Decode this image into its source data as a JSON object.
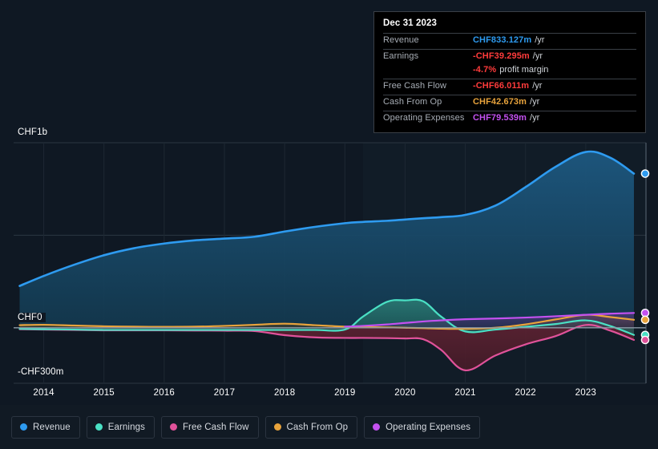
{
  "tooltip": {
    "date": "Dec 31 2023",
    "rows": [
      {
        "key": "Revenue",
        "value": "CHF833.127m",
        "unit": "/yr",
        "color": "#2e9bf0"
      },
      {
        "key": "Earnings",
        "value": "-CHF39.295m",
        "unit": "/yr",
        "color": "#ff3b3b"
      },
      {
        "key": "",
        "value": "-4.7%",
        "unit": "profit margin",
        "color": "#ff3b3b",
        "sub": true
      },
      {
        "key": "Free Cash Flow",
        "value": "-CHF66.011m",
        "unit": "/yr",
        "color": "#ff3b3b"
      },
      {
        "key": "Cash From Op",
        "value": "CHF42.673m",
        "unit": "/yr",
        "color": "#e8a33c"
      },
      {
        "key": "Operating Expenses",
        "value": "CHF79.539m",
        "unit": "/yr",
        "color": "#c451f0"
      }
    ]
  },
  "axes": {
    "y_top": "CHF1b",
    "y_zero": "CHF0",
    "y_bottom": "-CHF300m",
    "x_ticks": [
      "2014",
      "2015",
      "2016",
      "2017",
      "2018",
      "2019",
      "2020",
      "2021",
      "2022",
      "2023"
    ]
  },
  "legend": {
    "items": [
      {
        "label": "Revenue",
        "color": "#2e9bf0"
      },
      {
        "label": "Earnings",
        "color": "#4ae0c4"
      },
      {
        "label": "Free Cash Flow",
        "color": "#e0529a"
      },
      {
        "label": "Cash From Op",
        "color": "#e8a33c"
      },
      {
        "label": "Operating Expenses",
        "color": "#c451f0"
      }
    ]
  },
  "chart_data": {
    "type": "area",
    "title": "",
    "xlabel": "",
    "ylabel": "",
    "currency": "CHF",
    "units": "millions",
    "grid": true,
    "legend_position": "bottom",
    "xlim": [
      2013.5,
      2024.0
    ],
    "ylim": [
      -300,
      1000
    ],
    "y_ticks": [
      1000,
      500,
      0,
      -300
    ],
    "y_tick_labels": [
      "CHF1b",
      "",
      "CHF0",
      "-CHF300m"
    ],
    "x": [
      2013.6,
      2014.0,
      2014.5,
      2015.0,
      2015.5,
      2016.0,
      2016.5,
      2017.0,
      2017.5,
      2018.0,
      2018.5,
      2019.0,
      2019.3,
      2019.7,
      2020.0,
      2020.3,
      2020.6,
      2021.0,
      2021.5,
      2022.0,
      2022.5,
      2023.0,
      2023.4,
      2023.8
    ],
    "series": [
      {
        "name": "Revenue",
        "color": "#2e9bf0",
        "fill": "#16384f",
        "values": [
          226,
          280,
          340,
          392,
          430,
          455,
          472,
          482,
          492,
          520,
          545,
          565,
          572,
          578,
          585,
          592,
          598,
          610,
          660,
          760,
          870,
          950,
          920,
          833
        ]
      },
      {
        "name": "Earnings",
        "color": "#4ae0c4",
        "fill": "#1d5d5b",
        "values": [
          -6,
          -8,
          -10,
          -12,
          -12,
          -12,
          -12,
          -12,
          -12,
          -12,
          -12,
          -10,
          60,
          140,
          148,
          143,
          60,
          -20,
          -10,
          5,
          20,
          40,
          10,
          -39
        ]
      },
      {
        "name": "Free Cash Flow",
        "color": "#e0529a",
        "fill": "#5a2030",
        "values": [
          -8,
          -10,
          -12,
          -14,
          -14,
          -14,
          -15,
          -16,
          -18,
          -40,
          -52,
          -55,
          -55,
          -56,
          -58,
          -62,
          -120,
          -230,
          -150,
          -90,
          -45,
          15,
          -15,
          -66
        ]
      },
      {
        "name": "Cash From Op",
        "color": "#e8a33c",
        "fill": "#5a4520",
        "values": [
          14,
          16,
          12,
          8,
          6,
          5,
          6,
          10,
          16,
          22,
          14,
          6,
          4,
          2,
          0,
          -2,
          -5,
          -6,
          0,
          18,
          45,
          70,
          58,
          43
        ]
      },
      {
        "name": "Operating Expenses",
        "color": "#c451f0",
        "fill": "#4a2a66",
        "values": [
          null,
          null,
          null,
          null,
          null,
          null,
          null,
          null,
          null,
          null,
          null,
          6,
          10,
          18,
          26,
          34,
          40,
          46,
          50,
          55,
          62,
          70,
          76,
          80
        ]
      }
    ],
    "end_markers": [
      {
        "name": "Revenue",
        "value": 833,
        "color": "#2e9bf0"
      },
      {
        "name": "Operating Expenses",
        "value": 80,
        "color": "#c451f0"
      },
      {
        "name": "Cash From Op",
        "value": 43,
        "color": "#e8a33c"
      },
      {
        "name": "Earnings",
        "value": -39,
        "color": "#4ae0c4"
      },
      {
        "name": "Free Cash Flow",
        "value": -66,
        "color": "#e0529a"
      }
    ]
  }
}
